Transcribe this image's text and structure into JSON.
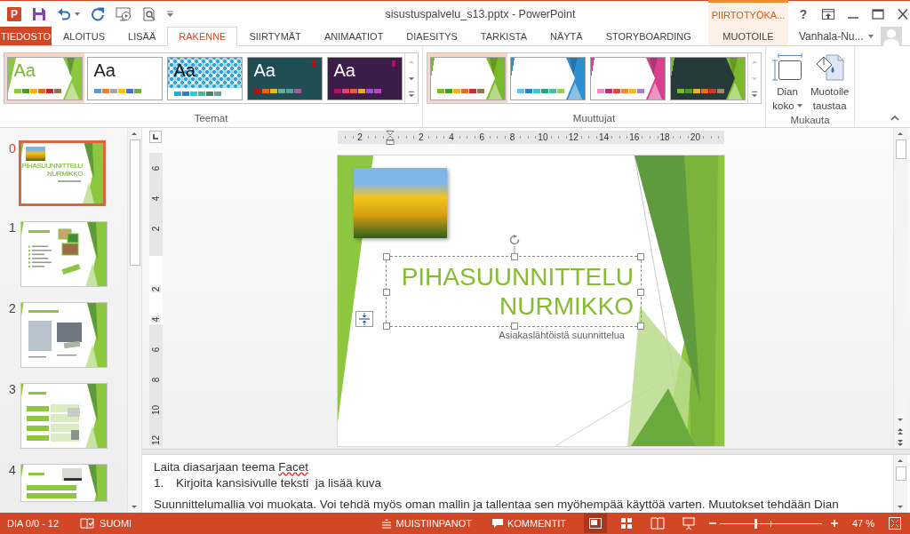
{
  "window": {
    "logo_letter": "P",
    "title": "sisustuspalvelu_s13.pptx - PowerPoint",
    "context_header": "PIIRTOTYÖKA...",
    "help": "?"
  },
  "tabs": [
    {
      "label": "TIEDOSTO",
      "kind": "file",
      "selected": false
    },
    {
      "label": "ALOITUS",
      "kind": "normal",
      "selected": false
    },
    {
      "label": "LISÄÄ",
      "kind": "normal",
      "selected": false
    },
    {
      "label": "RAKENNE",
      "kind": "normal",
      "selected": true
    },
    {
      "label": "SIIRTYMÄT",
      "kind": "normal",
      "selected": false
    },
    {
      "label": "ANIMAATIOT",
      "kind": "normal",
      "selected": false
    },
    {
      "label": "DIAESITYS",
      "kind": "normal",
      "selected": false
    },
    {
      "label": "TARKISTA",
      "kind": "normal",
      "selected": false
    },
    {
      "label": "NÄYTÄ",
      "kind": "normal",
      "selected": false
    },
    {
      "label": "STORYBOARDING",
      "kind": "normal",
      "selected": false
    },
    {
      "label": "MUOTOILE",
      "kind": "contextual",
      "selected": false
    }
  ],
  "account": {
    "name": "Vanhala-Nu..."
  },
  "ribbon": {
    "themes": {
      "label": "Teemat",
      "items": [
        {
          "label": "Aa",
          "kind": "facet",
          "color": "#ffffff",
          "selected": true,
          "swatches": [
            {
              "color": "#8dc63f"
            },
            {
              "color": "#4e9a2a"
            },
            {
              "color": "#f0b31c"
            },
            {
              "color": "#e16b1c"
            },
            {
              "color": "#c8262d"
            },
            {
              "color": "#8c7550"
            }
          ]
        },
        {
          "label": "Aa",
          "kind": "plain",
          "color": "#ffffff",
          "selected": false,
          "swatches": [
            {
              "color": "#5b9bd5"
            },
            {
              "color": "#ed7d31"
            },
            {
              "color": "#a5a5a5"
            },
            {
              "color": "#ffc000"
            },
            {
              "color": "#4472c4"
            },
            {
              "color": "#70ad47"
            }
          ]
        },
        {
          "label": "Aa",
          "kind": "pattern",
          "color": "#2aa3d6",
          "selected": false,
          "swatches": [
            {
              "color": "#1cade4"
            },
            {
              "color": "#2683c6"
            },
            {
              "color": "#27ced7"
            },
            {
              "color": "#42ba97"
            },
            {
              "color": "#3e8853"
            },
            {
              "color": "#62a39f"
            }
          ]
        },
        {
          "label": "Aa",
          "kind": "dark",
          "color": "#1f4e55",
          "selected": false,
          "swatches": [
            {
              "color": "#b01513"
            },
            {
              "color": "#ea6312"
            },
            {
              "color": "#e6b729"
            },
            {
              "color": "#6aac90"
            },
            {
              "color": "#5f9c9d"
            },
            {
              "color": "#9e5e9b"
            }
          ]
        },
        {
          "label": "Aa",
          "kind": "dark",
          "color": "#3b1d47",
          "selected": false,
          "swatches": [
            {
              "color": "#b31166"
            },
            {
              "color": "#e33d6f"
            },
            {
              "color": "#e45f3c"
            },
            {
              "color": "#e9a93a"
            },
            {
              "color": "#9356d1"
            },
            {
              "color": "#b849be"
            }
          ]
        }
      ]
    },
    "variants": {
      "label": "Muuttujat",
      "items": [
        {
          "kind": "light",
          "color": "#7ab929",
          "selected": true,
          "swatches": [
            {
              "color": "#7ab929"
            },
            {
              "color": "#3f9d2e"
            },
            {
              "color": "#f1b21e"
            },
            {
              "color": "#e66c1d"
            },
            {
              "color": "#c3302c"
            },
            {
              "color": "#92774f"
            }
          ]
        },
        {
          "kind": "light",
          "color": "#2e8fd0",
          "selected": false,
          "swatches": [
            {
              "color": "#58c2e8"
            },
            {
              "color": "#2e7cc1"
            },
            {
              "color": "#3fc6bd"
            },
            {
              "color": "#2f9f86"
            },
            {
              "color": "#4fba9f"
            },
            {
              "color": "#9acd5a"
            }
          ]
        },
        {
          "kind": "light",
          "color": "#d9408f",
          "selected": false,
          "swatches": [
            {
              "color": "#f08cc0"
            },
            {
              "color": "#b5307a"
            },
            {
              "color": "#e0463c"
            },
            {
              "color": "#ef8a2a"
            },
            {
              "color": "#f5b731"
            },
            {
              "color": "#a97fd6"
            }
          ]
        },
        {
          "kind": "dark",
          "color": "#7ab929",
          "selected": false,
          "swatches": [
            {
              "color": "#7ab929"
            },
            {
              "color": "#4c9a2a"
            },
            {
              "color": "#e8b530"
            },
            {
              "color": "#e36d24"
            },
            {
              "color": "#c73a2c"
            },
            {
              "color": "#9d8a6a"
            }
          ]
        }
      ]
    },
    "customize": {
      "label": "Mukauta",
      "buttons": [
        {
          "kind": "slide-size",
          "lines": [
            "Dian",
            "koko"
          ],
          "dropdown": true
        },
        {
          "kind": "background",
          "lines": [
            "Muotoile",
            "taustaa"
          ],
          "dropdown": false
        }
      ]
    }
  },
  "slides_panel": {
    "slides": [
      {
        "number": "0",
        "kind": "title",
        "selected": true,
        "title_lines": [
          "PIHASUUNNITTELU",
          "NURMIKKO"
        ]
      },
      {
        "number": "1",
        "kind": "bullets",
        "selected": false
      },
      {
        "number": "2",
        "kind": "photos",
        "selected": false
      },
      {
        "number": "3",
        "kind": "table",
        "selected": false
      },
      {
        "number": "4",
        "kind": "list",
        "selected": false
      }
    ]
  },
  "rulers": {
    "horizontal": {
      "before_zero": [
        "2"
      ],
      "after_zero": [
        "2",
        "4",
        "6",
        "8",
        "10",
        "12",
        "14",
        "16",
        "18",
        "20"
      ]
    },
    "vertical": {
      "before_zero": [
        "6",
        "4",
        "2"
      ],
      "after_zero": [
        "2",
        "4",
        "6",
        "8",
        "10",
        "12"
      ]
    }
  },
  "slide": {
    "title_lines": [
      "PIHASUUNNITTELU",
      "NURMIKKO"
    ],
    "subtitle": "Asiakaslähtöistä suunnittelua",
    "box_selected": true
  },
  "notes": {
    "paragraphs": [
      {
        "kind": "text",
        "parts": [
          {
            "text": "Laita diasarjaan teema ",
            "misspelled": false
          },
          {
            "text": "Facet",
            "misspelled": true
          }
        ]
      },
      {
        "kind": "numbered",
        "number": "1.",
        "parts": [
          {
            "text": "Kirjoita kansisivulle teksti  ja lisää kuva",
            "misspelled": false
          }
        ]
      },
      {
        "kind": "text",
        "parts": [
          {
            "text": "Suunnittelumallia voi muokata. Voi tehdä myös oman mallin ja tallentaa sen myöhempää käyttöä varten. Muutokset tehdään Dian",
            "misspelled": false
          }
        ]
      }
    ]
  },
  "status_bar": {
    "slide_info": "DIA 0/0 - 12",
    "language": "SUOMI",
    "notes_label": "MUISTIINPANOT",
    "comments_label": "KOMMENTIT",
    "views": [
      {
        "kind": "normal",
        "selected": true
      },
      {
        "kind": "sorter",
        "selected": false
      },
      {
        "kind": "reading",
        "selected": false
      },
      {
        "kind": "slideshow",
        "selected": false
      }
    ],
    "zoom": {
      "level": 0.35,
      "reading": "47 %"
    }
  }
}
